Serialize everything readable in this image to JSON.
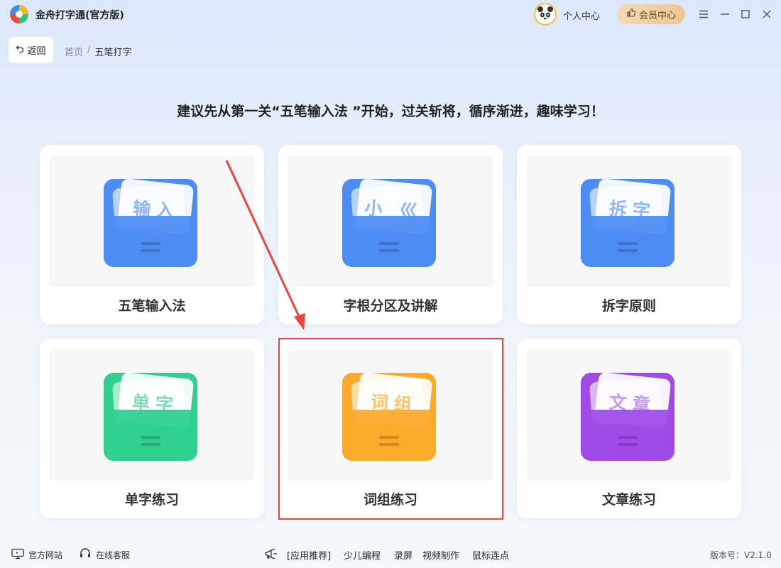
{
  "app": {
    "title": "金舟打字通(官方版)"
  },
  "header": {
    "personal_center": "个人中心",
    "vip_center": "会员中心",
    "icons": [
      "menu-icon",
      "minimize-icon",
      "maximize-icon",
      "close-icon"
    ]
  },
  "nav": {
    "back_label": "返回",
    "breadcrumb": {
      "home": "首页",
      "sep": "/",
      "current": "五笔打字"
    }
  },
  "headline": "建议先从第一关“五笔输入法 ”开始，过关斩将，循序渐进，趣味学习！",
  "cards": [
    {
      "label": "五笔输入法",
      "paper": "输入法",
      "color": "#4d8df3"
    },
    {
      "label": "字根分区及讲解",
      "paper": "小 巛",
      "color": "#4d8df3"
    },
    {
      "label": "拆字原则",
      "paper": "拆字",
      "color": "#4d8df3"
    },
    {
      "label": "单字练习",
      "paper": "单字",
      "color": "#2ecf8f"
    },
    {
      "label": "词组练习",
      "paper": "词组",
      "color": "#fbaa2a"
    },
    {
      "label": "文章练习",
      "paper": "文章",
      "color": "#a04be8"
    }
  ],
  "footer": {
    "official_site": "官方网站",
    "online_service": "在线客服",
    "recommend_label": "[应用推荐]",
    "recommend_items": [
      "少儿编程",
      "录屏",
      "视频制作",
      "鼠标连点"
    ],
    "version": "版本号：V2.1.0"
  }
}
